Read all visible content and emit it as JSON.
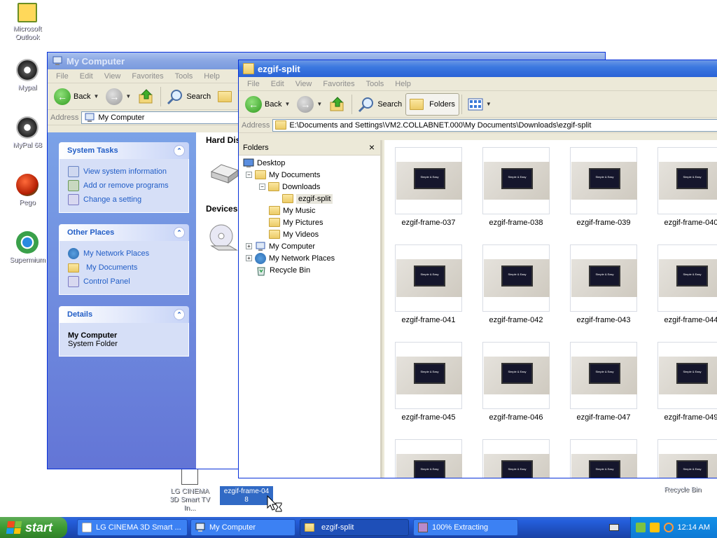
{
  "desktop": {
    "icons": [
      {
        "label": "Microsoft Outlook",
        "name": "outlook-icon"
      },
      {
        "label": "Mypal",
        "name": "mypal-icon"
      },
      {
        "label": "MyPal 68",
        "name": "mypal68-icon"
      },
      {
        "label": "Pego",
        "name": "pego-icon"
      },
      {
        "label": "Supermium",
        "name": "supermium-icon"
      },
      {
        "label": "LG CINEMA 3D Smart TV In...",
        "name": "video-file-icon"
      },
      {
        "label": "Recycle Bin",
        "name": "recycle-bin-icon"
      }
    ],
    "dragging": {
      "line1": "ezgif-frame-04",
      "line2": "8"
    }
  },
  "my_computer_window": {
    "title": "My Computer",
    "menu": [
      "File",
      "Edit",
      "View",
      "Favorites",
      "Tools",
      "Help"
    ],
    "toolbar": {
      "back": "Back",
      "search": "Search",
      "folders_trunc": "F"
    },
    "address_label": "Address",
    "address_value": "My Computer",
    "sections": {
      "hard_disks": "Hard Dis",
      "devices": "Devices"
    },
    "system_tasks": {
      "title": "System Tasks",
      "items": [
        "View system information",
        "Add or remove programs",
        "Change a setting"
      ]
    },
    "other_places": {
      "title": "Other Places",
      "items": [
        "My Network Places",
        "My Documents",
        "Control Panel"
      ]
    },
    "details": {
      "title": "Details",
      "name": "My Computer",
      "type": "System Folder"
    }
  },
  "ezgif_window": {
    "title": "ezgif-split",
    "menu": [
      "File",
      "Edit",
      "View",
      "Favorites",
      "Tools",
      "Help"
    ],
    "toolbar": {
      "back": "Back",
      "search": "Search",
      "folders": "Folders"
    },
    "address_label": "Address",
    "address_value": "E:\\Documents and Settings\\VM2.COLLABNET.000\\My Documents\\Downloads\\ezgif-split",
    "folders_pane": {
      "title": "Folders",
      "close": "×",
      "tree": [
        "Desktop",
        "My Documents",
        "Downloads",
        "ezgif-split",
        "My Music",
        "My Pictures",
        "My Videos",
        "My Computer",
        "My Network Places",
        "Recycle Bin"
      ]
    },
    "thumb_text": {
      "line1": "Simple & Easy",
      "line2": "LG Smart TV"
    },
    "files": [
      "ezgif-frame-037",
      "ezgif-frame-038",
      "ezgif-frame-039",
      "ezgif-frame-040",
      "ezgif-frame-041",
      "ezgif-frame-042",
      "ezgif-frame-043",
      "ezgif-frame-044",
      "ezgif-frame-045",
      "ezgif-frame-046",
      "ezgif-frame-047",
      "ezgif-frame-049"
    ]
  },
  "taskbar": {
    "start": "start",
    "items": [
      "LG CINEMA 3D Smart ...",
      "My Computer",
      "ezgif-split",
      "100% Extracting"
    ],
    "clock": "12:14 AM"
  }
}
